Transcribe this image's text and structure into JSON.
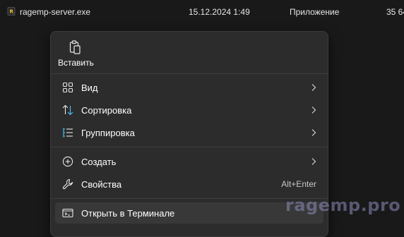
{
  "file": {
    "name": "ragemp-server.exe",
    "date": "15.12.2024 1:49",
    "type": "Приложение",
    "size": "35 64",
    "icon": "exe-file-icon"
  },
  "menu": {
    "top_actions": [
      {
        "label": "Вставить",
        "icon": "paste-icon"
      }
    ],
    "groups": [
      [
        {
          "label": "Вид",
          "icon": "grid-view-icon",
          "submenu": true
        },
        {
          "label": "Сортировка",
          "icon": "sort-icon",
          "submenu": true
        },
        {
          "label": "Группировка",
          "icon": "group-list-icon",
          "submenu": true
        }
      ],
      [
        {
          "label": "Создать",
          "icon": "add-circle-icon",
          "submenu": true
        },
        {
          "label": "Свойства",
          "icon": "wrench-icon",
          "shortcut": "Alt+Enter"
        }
      ],
      [
        {
          "label": "Открыть в Терминале",
          "icon": "terminal-icon",
          "highlighted": true
        }
      ]
    ]
  },
  "watermark": "ragemp.pro",
  "colors": {
    "background": "#191919",
    "menu_bg": "#2c2c2c",
    "accent": "#4cc2ff",
    "watermark": "#8c8cbe"
  }
}
